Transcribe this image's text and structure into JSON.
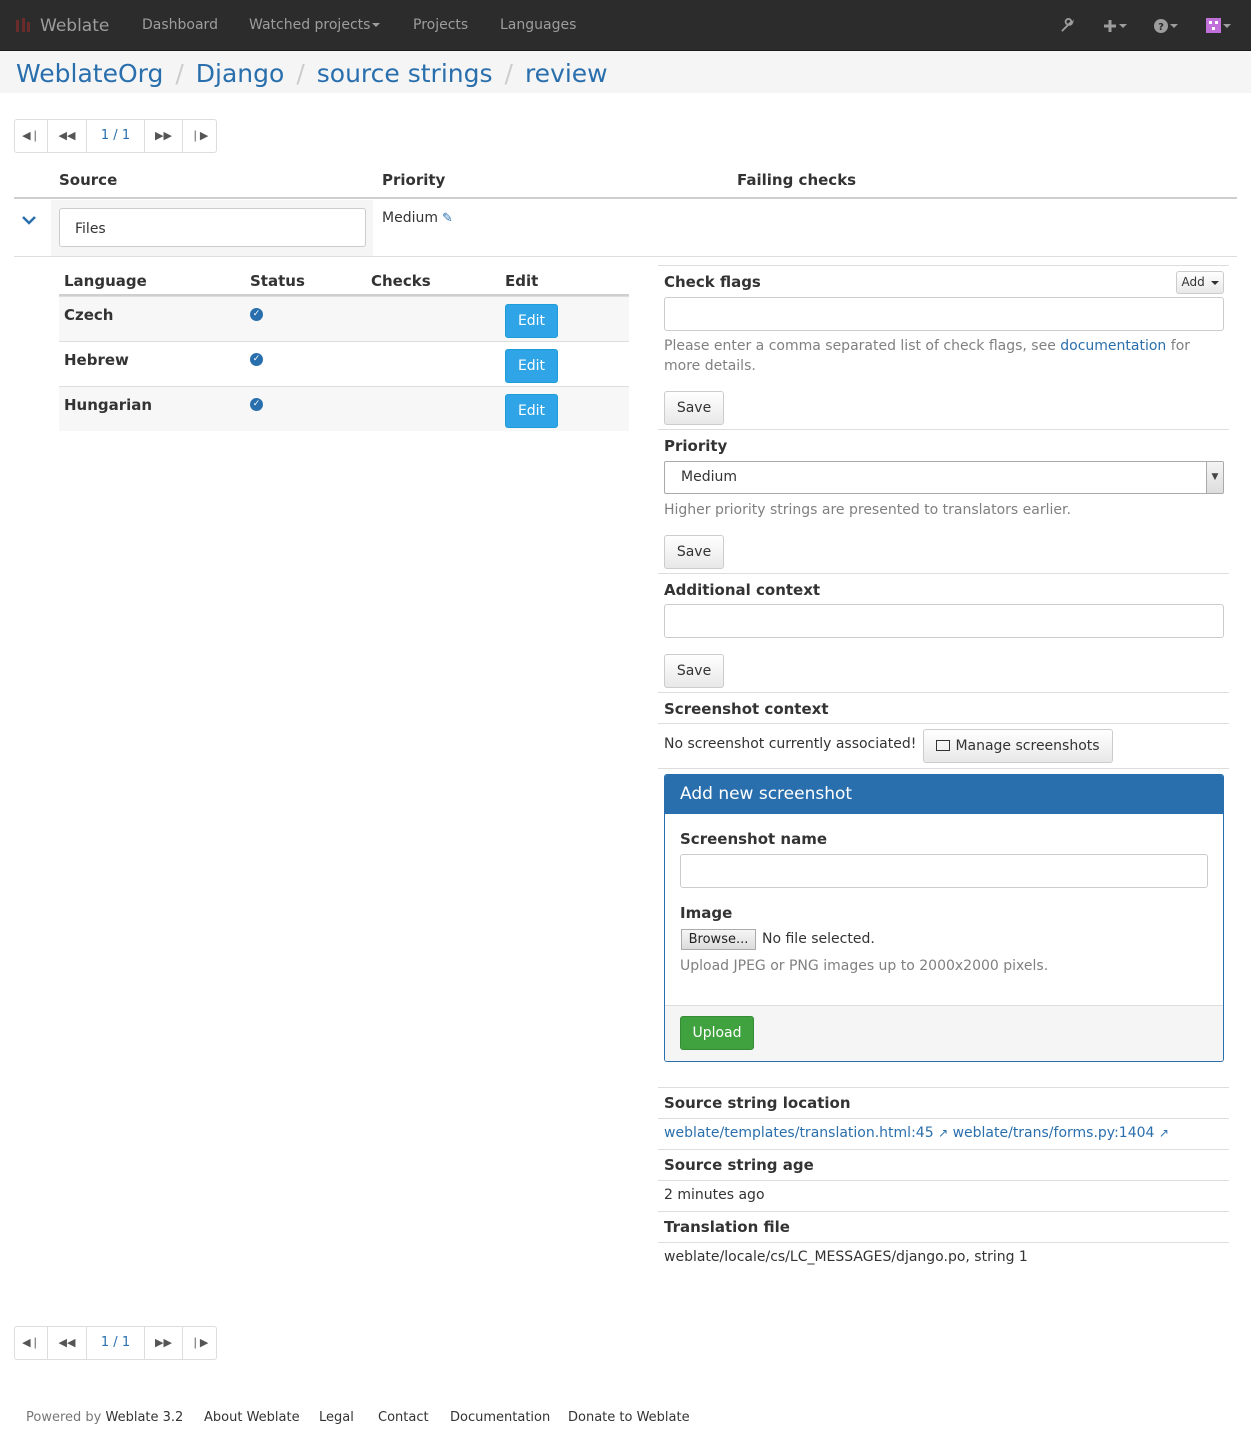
{
  "navbar": {
    "brand": "Weblate",
    "items": [
      "Dashboard",
      "Watched projects",
      "Projects",
      "Languages"
    ]
  },
  "breadcrumb": [
    "WeblateOrg",
    "Django",
    "source strings",
    "review"
  ],
  "pagination": {
    "position": "1 / 1"
  },
  "table": {
    "headers": {
      "source": "Source",
      "priority": "Priority",
      "checks": "Failing checks"
    },
    "source_text": "Files",
    "priority_value": "Medium"
  },
  "languages": {
    "headers": {
      "language": "Language",
      "status": "Status",
      "checks": "Checks",
      "edit": "Edit"
    },
    "rows": [
      {
        "language": "Czech",
        "edit": "Edit"
      },
      {
        "language": "Hebrew",
        "edit": "Edit"
      },
      {
        "language": "Hungarian",
        "edit": "Edit"
      }
    ]
  },
  "check_flags": {
    "label": "Check flags",
    "add_label": "Add",
    "help_prefix": "Please enter a comma separated list of check flags, see ",
    "help_link": "documentation",
    "help_suffix": " for",
    "help_line2": "more details.",
    "save": "Save"
  },
  "priority": {
    "label": "Priority",
    "selected": "Medium",
    "help": "Higher priority strings are presented to translators earlier.",
    "save": "Save"
  },
  "additional_context": {
    "label": "Additional context",
    "save": "Save"
  },
  "screenshot_context": {
    "label": "Screenshot context",
    "none_text": "No screenshot currently associated!",
    "manage_label": "Manage screenshots"
  },
  "add_screenshot": {
    "title": "Add new screenshot",
    "name_label": "Screenshot name",
    "image_label": "Image",
    "browse_label": "Browse...",
    "no_file": "No file selected.",
    "help": "Upload JPEG or PNG images up to 2000x2000 pixels.",
    "upload": "Upload"
  },
  "source_location": {
    "label": "Source string location",
    "links": [
      "weblate/templates/translation.html:45",
      "weblate/trans/forms.py:1404"
    ]
  },
  "source_age": {
    "label": "Source string age",
    "value": "2 minutes ago"
  },
  "translation_file": {
    "label": "Translation file",
    "value": "weblate/locale/cs/LC_MESSAGES/django.po, string 1"
  },
  "footer": {
    "powered_prefix": "Powered by ",
    "powered_link": "Weblate 3.2",
    "links": [
      "About Weblate",
      "Legal",
      "Contact",
      "Documentation",
      "Donate to Weblate"
    ]
  },
  "colors": {
    "navbar": "#2c2c2c",
    "link": "#2a6fad",
    "edit_button": "#2fa4e7",
    "upload_button": "#3fa23f"
  },
  "icons": [
    "wrench-icon",
    "plus-icon",
    "help-icon",
    "avatar",
    "chevron-down-icon",
    "pencil-icon",
    "check-circle-icon",
    "image-icon",
    "external-link-icon"
  ]
}
